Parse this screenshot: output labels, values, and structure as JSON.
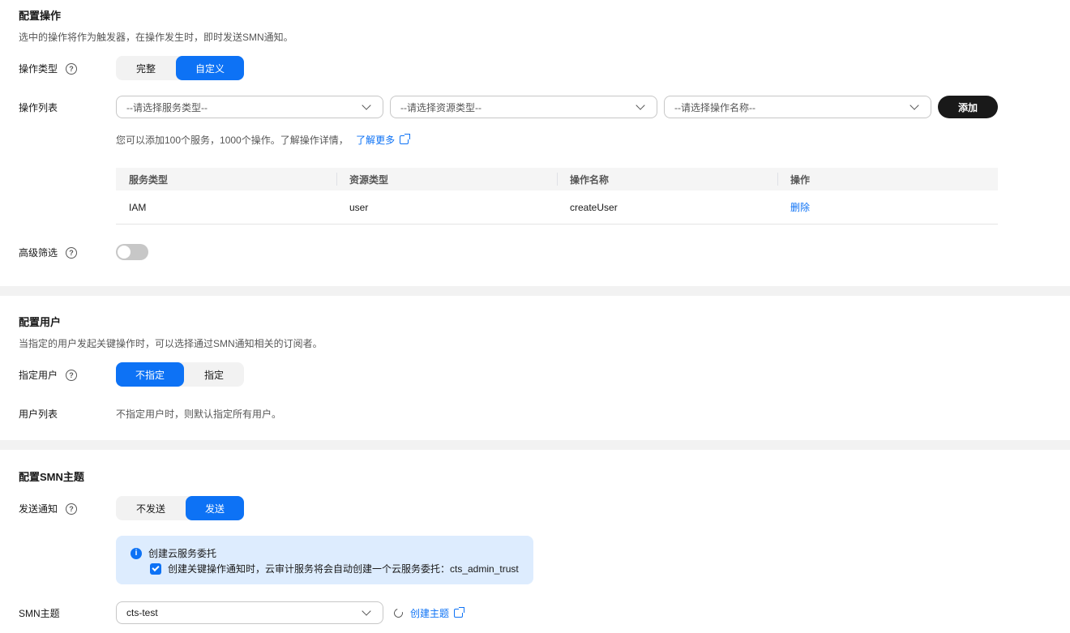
{
  "ops_section": {
    "title": "配置操作",
    "desc": "选中的操作将作为触发器，在操作发生时，即时发送SMN通知。",
    "type_label": "操作类型",
    "type_options": [
      "完整",
      "自定义"
    ],
    "type_selected": "自定义",
    "list_label": "操作列表",
    "service_placeholder": "--请选择服务类型--",
    "resource_placeholder": "--请选择资源类型--",
    "operation_placeholder": "--请选择操作名称--",
    "add_button": "添加",
    "hint": "您可以添加100个服务，1000个操作。了解操作详情，",
    "learn_more": "了解更多",
    "table": {
      "headers": [
        "服务类型",
        "资源类型",
        "操作名称",
        "操作"
      ],
      "rows": [
        {
          "service": "IAM",
          "resource": "user",
          "operation": "createUser",
          "action": "删除"
        }
      ]
    },
    "filter_label": "高级筛选",
    "filter_enabled": false
  },
  "user_section": {
    "title": "配置用户",
    "desc": "当指定的用户发起关键操作时，可以选择通过SMN通知相关的订阅者。",
    "specify_label": "指定用户",
    "specify_options": [
      "不指定",
      "指定"
    ],
    "specify_selected": "不指定",
    "list_label": "用户列表",
    "list_text": "不指定用户时，则默认指定所有用户。"
  },
  "smn_section": {
    "title": "配置SMN主题",
    "send_label": "发送通知",
    "send_options": [
      "不发送",
      "发送"
    ],
    "send_selected": "发送",
    "info_title": "创建云服务委托",
    "info_text": "创建关键操作通知时，云审计服务将会自动创建一个云服务委托：cts_admin_trust",
    "info_checked": true,
    "topic_label": "SMN主题",
    "topic_value": "cts-test",
    "create_topic": "创建主题"
  },
  "colors": {
    "accent": "#0d72f5",
    "dark_button": "#191919",
    "info_bg": "#ddecfe"
  },
  "icons": [
    "help-icon",
    "chevron-down-icon",
    "external-link-icon",
    "info-icon",
    "checkbox-checked-icon",
    "refresh-icon"
  ]
}
